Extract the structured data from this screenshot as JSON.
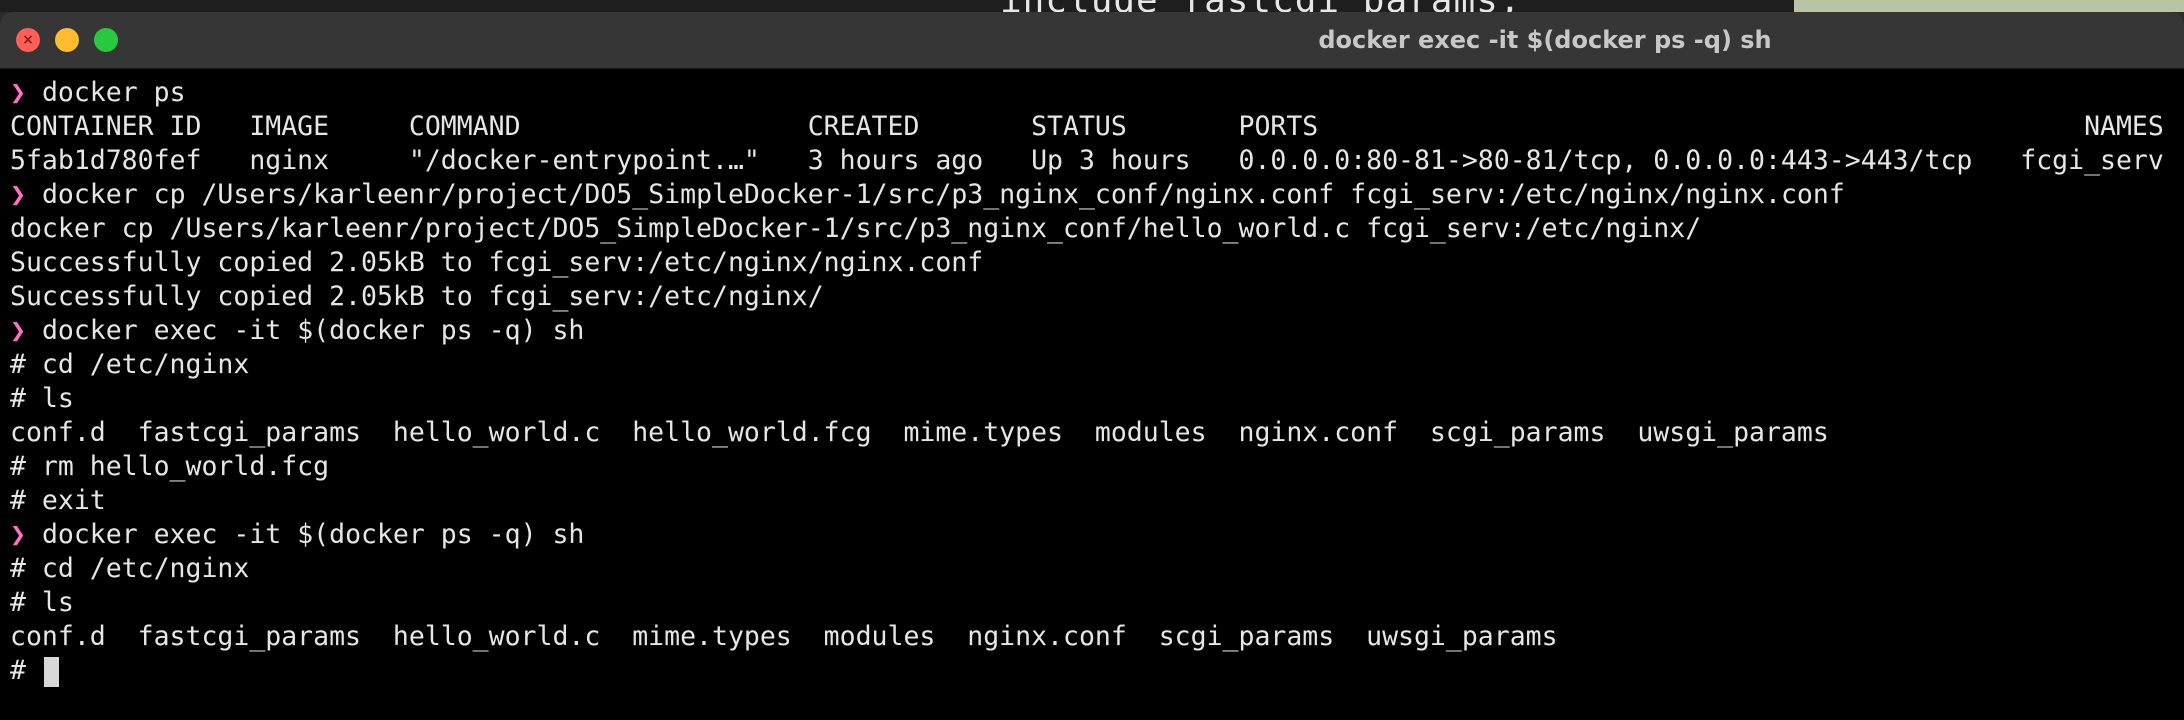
{
  "window": {
    "title": "docker exec -it $(docker ps -q) sh",
    "background_peek": "include fastcgi_params;"
  },
  "colors": {
    "terminal_bg": "#000000",
    "text": "#e6e6e6",
    "prompt_arrow": "#ff6ec7",
    "close": "#ff5f57",
    "minimize": "#febc2e",
    "zoom": "#28c840"
  },
  "terminal": {
    "prompt_symbol": "❯",
    "lines": {
      "l1": "docker ps",
      "l2": "CONTAINER ID   IMAGE     COMMAND                  CREATED       STATUS       PORTS                                                NAMES",
      "l3": "5fab1d780fef   nginx     \"/docker-entrypoint.…\"   3 hours ago   Up 3 hours   0.0.0.0:80-81->80-81/tcp, 0.0.0.0:443->443/tcp   fcgi_serv",
      "l4": "docker cp /Users/karleenr/project/DO5_SimpleDocker-1/src/p3_nginx_conf/nginx.conf fcgi_serv:/etc/nginx/nginx.conf",
      "l5": "docker cp /Users/karleenr/project/DO5_SimpleDocker-1/src/p3_nginx_conf/hello_world.c fcgi_serv:/etc/nginx/",
      "l6": "Successfully copied 2.05kB to fcgi_serv:/etc/nginx/nginx.conf",
      "l7": "Successfully copied 2.05kB to fcgi_serv:/etc/nginx/",
      "l8": "docker exec -it $(docker ps -q) sh",
      "l9": "# cd /etc/nginx",
      "l10": "# ls",
      "l11": "conf.d  fastcgi_params  hello_world.c  hello_world.fcg  mime.types  modules  nginx.conf  scgi_params  uwsgi_params",
      "l12": "# rm hello_world.fcg",
      "l13": "# exit",
      "l14": "docker exec -it $(docker ps -q) sh",
      "l15": "# cd /etc/nginx",
      "l16": "# ls",
      "l17": "conf.d  fastcgi_params  hello_world.c  mime.types  modules  nginx.conf  scgi_params  uwsgi_params",
      "l18": "# "
    }
  }
}
